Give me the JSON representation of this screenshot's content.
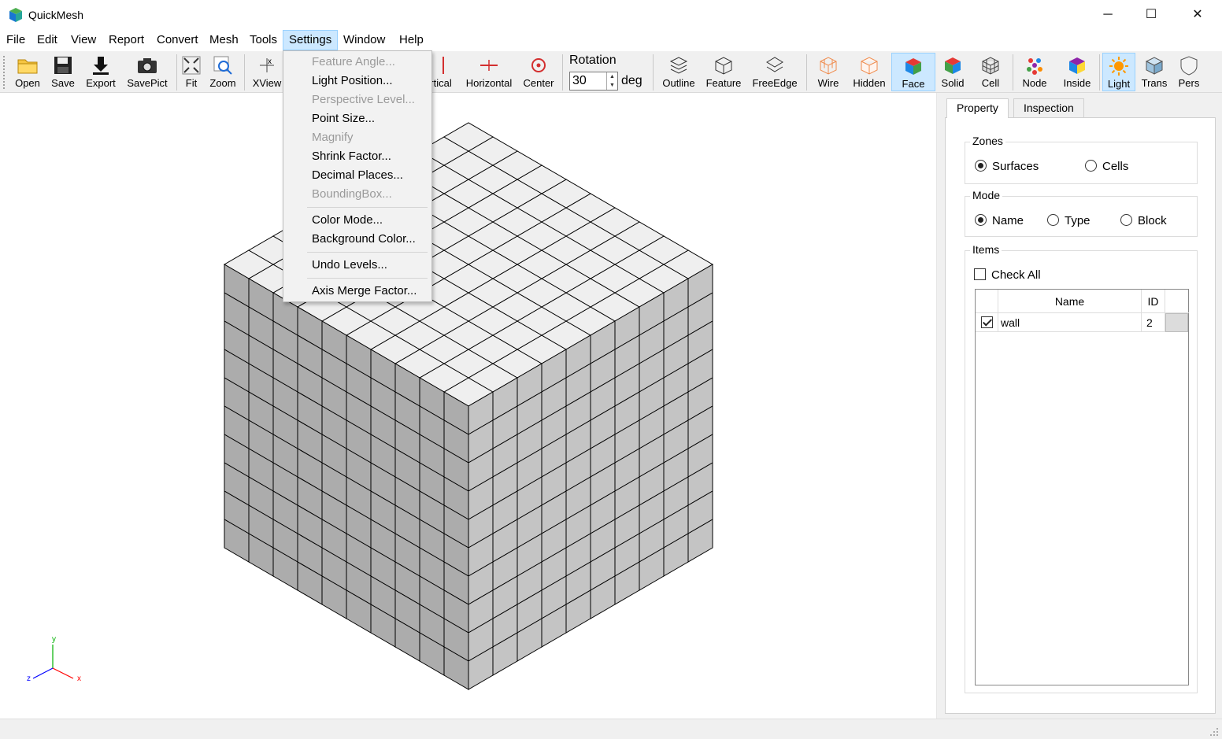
{
  "window": {
    "title": "QuickMesh",
    "minimize": "─",
    "maximize": "☐",
    "close": "✕"
  },
  "menubar": [
    "File",
    "Edit",
    "View",
    "Report",
    "Convert",
    "Mesh",
    "Tools",
    "Settings",
    "Window",
    "Help"
  ],
  "settings_menu": {
    "items": [
      {
        "label": "Feature Angle...",
        "enabled": false
      },
      {
        "label": "Light Position...",
        "enabled": true
      },
      {
        "label": "Perspective Level...",
        "enabled": false
      },
      {
        "label": "Point Size...",
        "enabled": true
      },
      {
        "label": "Magnify",
        "enabled": false
      },
      {
        "label": "Shrink Factor...",
        "enabled": true
      },
      {
        "label": "Decimal Places...",
        "enabled": true
      },
      {
        "label": "BoundingBox...",
        "enabled": false
      },
      {
        "label": "Color Mode...",
        "enabled": true
      },
      {
        "label": "Background Color...",
        "enabled": true
      },
      {
        "label": "Undo Levels...",
        "enabled": true
      },
      {
        "label": "Axis Merge Factor...",
        "enabled": true
      }
    ]
  },
  "toolbar": {
    "open": "Open",
    "save": "Save",
    "export": "Export",
    "savepict": "SavePict",
    "fit": "Fit",
    "zoom": "Zoom",
    "xview": "XView",
    "vertical": "rtical",
    "horizontal": "Horizontal",
    "center": "Center",
    "rotation_label": "Rotation",
    "rotation_value": "30",
    "rotation_unit": "deg",
    "outline": "Outline",
    "feature": "Feature",
    "freeedge": "FreeEdge",
    "wire": "Wire",
    "hidden": "Hidden",
    "face": "Face",
    "solid": "Solid",
    "cell": "Cell",
    "node": "Node",
    "inside": "Inside",
    "light": "Light",
    "trans": "Trans",
    "pers": "Pers"
  },
  "axes": {
    "x": "x",
    "y": "y",
    "z": "z"
  },
  "panel": {
    "tabs": [
      "Property",
      "Inspection"
    ],
    "zones": {
      "title": "Zones",
      "options": [
        "Surfaces",
        "Cells"
      ],
      "selected": "Surfaces"
    },
    "mode": {
      "title": "Mode",
      "options": [
        "Name",
        "Type",
        "Block"
      ],
      "selected": "Name"
    },
    "items": {
      "title": "Items",
      "check_all": "Check All",
      "columns": [
        "Name",
        "ID"
      ],
      "rows": [
        {
          "name": "wall",
          "id": "2",
          "checked": true
        }
      ]
    }
  },
  "colors": {
    "face_top": "#efefef",
    "face_side": "#c4c4c4",
    "face_front": "#acacac",
    "edge": "#000000",
    "axis_x": "#ff0000",
    "axis_y": "#00b000",
    "axis_z": "#0000ff"
  },
  "mesh": {
    "divisions": 10
  }
}
